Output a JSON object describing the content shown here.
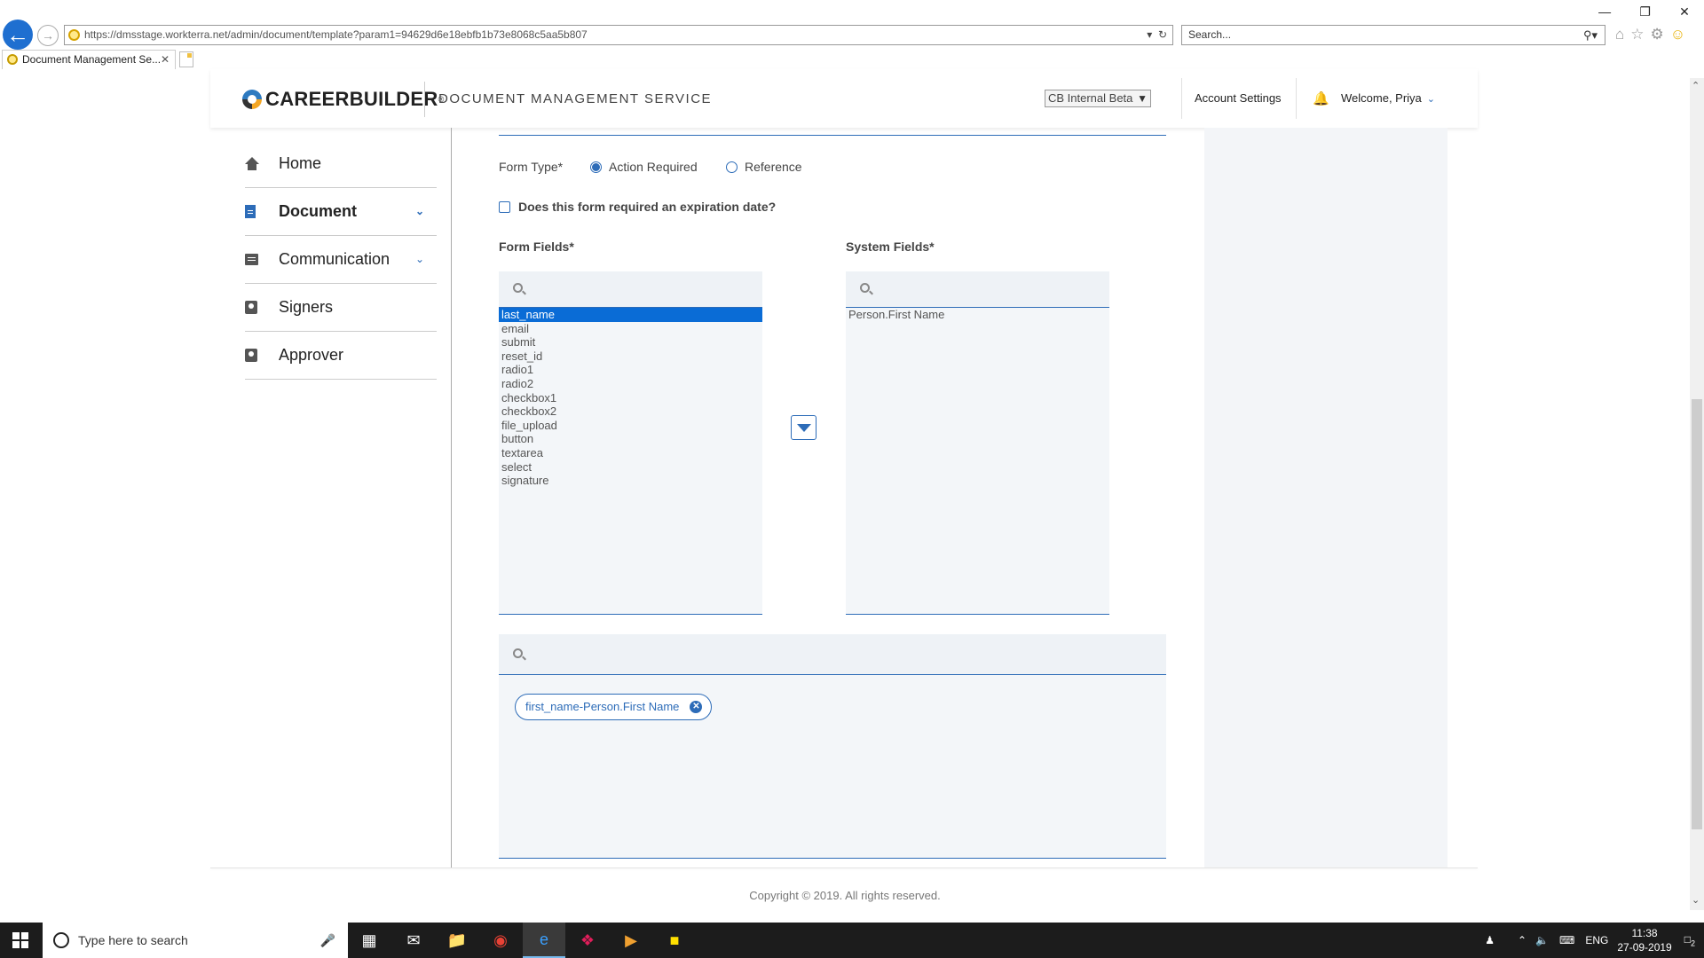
{
  "browser": {
    "url": "https://dmsstage.workterra.net/admin/document/template?param1=94629d6e18ebfb1b73e8068c5aa5b807",
    "search_placeholder": "Search...",
    "tab_title": "Document Management Se..."
  },
  "header": {
    "logo_text": "CAREERBUILDER",
    "service_title": "DOCUMENT MANAGEMENT SERVICE",
    "environment": "CB Internal Beta",
    "account_settings": "Account Settings",
    "welcome": "Welcome, Priya"
  },
  "sidebar": {
    "items": [
      {
        "label": "Home",
        "icon": "home-icon"
      },
      {
        "label": "Document",
        "icon": "document-icon",
        "active": true
      },
      {
        "label": "Communication",
        "icon": "message-icon"
      },
      {
        "label": "Signers",
        "icon": "badge-icon"
      },
      {
        "label": "Approver",
        "icon": "badge-icon"
      }
    ]
  },
  "form": {
    "form_type_label": "Form Type*",
    "options": [
      "Action Required",
      "Reference"
    ],
    "selected_option": "Action Required",
    "expiration_label": "Does this form required an expiration date?",
    "form_fields_label": "Form Fields*",
    "system_fields_label": "System Fields*",
    "form_fields": [
      "last_name",
      "email",
      "submit",
      "reset_id",
      "radio1",
      "radio2",
      "checkbox1",
      "checkbox2",
      "file_upload",
      "button",
      "textarea",
      "select",
      "signature"
    ],
    "selected_form_field": "last_name",
    "system_fields": [
      "Person.First Name"
    ],
    "mapped_chip": "first_name-Person.First Name"
  },
  "footer": {
    "copyright": "Copyright © 2019. All rights reserved."
  },
  "taskbar": {
    "search_placeholder": "Type here to search",
    "language": "ENG",
    "time": "11:38",
    "date": "27-09-2019",
    "notification_count": "2"
  },
  "colors": {
    "accent": "#2d6cb8",
    "selection": "#0a6cd6",
    "panel": "#f3f6f9"
  }
}
